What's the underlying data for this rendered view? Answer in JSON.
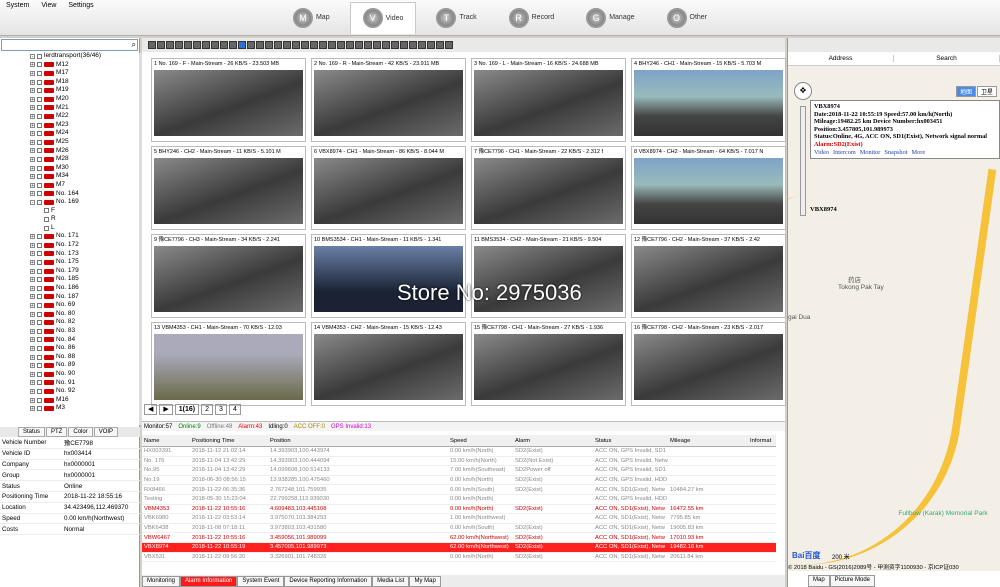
{
  "menu": [
    "System",
    "View",
    "Settings"
  ],
  "nav": [
    {
      "label": "Map",
      "icon": "M"
    },
    {
      "label": "Video",
      "icon": "V",
      "active": true
    },
    {
      "label": "Track",
      "icon": "T"
    },
    {
      "label": "Record",
      "icon": "R"
    },
    {
      "label": "Manage",
      "icon": "G"
    },
    {
      "label": "Other",
      "icon": "O"
    }
  ],
  "tree": {
    "root": "lerdtransport(36/46)",
    "items": [
      "M12",
      "M17",
      "M18",
      "M19",
      "M20",
      "M21",
      "M22",
      "M23",
      "M24",
      "M25",
      "M26",
      "M28",
      "M30",
      "M34",
      "M7",
      "No. 164",
      "No. 169"
    ],
    "children": [
      "F",
      "R",
      "L"
    ],
    "items2": [
      "No. 171",
      "No. 172",
      "No. 173",
      "No. 175",
      "No. 179",
      "No. 185",
      "No. 186",
      "No. 187",
      "No. 69",
      "No. 80",
      "No. 82",
      "No. 83",
      "No. 84",
      "No. 86",
      "No. 88",
      "No. 89",
      "No. 90",
      "No. 91",
      "No. 92",
      "M16",
      "M3"
    ]
  },
  "proptabs": [
    "Status",
    "PTZ",
    "Color",
    "VOIP"
  ],
  "props": [
    {
      "k": "Vehicle Number",
      "v": "豫CE7798"
    },
    {
      "k": "Vehicle ID",
      "v": "hx003414"
    },
    {
      "k": "Company",
      "v": "hx0000001"
    },
    {
      "k": "Group",
      "v": "hx0000001"
    },
    {
      "k": "Status",
      "v": "Online"
    },
    {
      "k": "Positioning Time",
      "v": "2018-11-22 18:55:16"
    },
    {
      "k": "Location",
      "v": "34.423496,112.469370"
    },
    {
      "k": "Speed",
      "v": "0.00 km/h(Northwest)"
    },
    {
      "k": "Costs",
      "v": "Normal"
    }
  ],
  "cells": [
    "1 No. 169 - F - Main-Stream - 26 KB/S - 23.503 MB",
    "2 No. 169 - R - Main-Stream - 42 KB/S - 23.911 MB",
    "3 No. 169 - L - Main-Stream - 16 KB/S - 24.688 MB",
    "4 BHY246 - CH1 - Main-Stream - 15 KB/S - 5.703 M",
    "5 BHY246 - CH2 - Main-Stream - 11 KB/S - 5.101 M",
    "6 VBX8974 - CH1 - Main-Stream - 86 KB/S - 8.044 M",
    "7 豫CE7796 - CH1 - Main-Stream - 22 KB/S - 2.312 f",
    "8 VBX8974 - CH2 - Main-Stream - 64 KB/S - 7.017 N",
    "9 豫CE7796 - CH3 - Main-Stream - 34 KB/S - 2.241",
    "10 BMS3534 - CH1 - Main-Stream - 11 KB/S - 1.341",
    "11 BMS3534 - CH2 - Main-Stream - 21 KB/S - 9.504",
    "12 豫CE7796 - CH2 - Main-Stream - 37 KB/S - 2.42",
    "13 VBM4353 - CH1 - Main-Stream - 70 KB/S - 12.03",
    "14 VBM4353 - CH2 - Main-Stream - 15 KB/S - 12.43",
    "15 豫CE7798 - CH1 - Main-Stream - 27 KB/S - 1.936",
    "16 豫CE7798 - CH2 - Main-Stream - 23 KB/S - 2.017"
  ],
  "pages": [
    "1(16)",
    "2",
    "3",
    "4"
  ],
  "statusline": {
    "monitor": "Monitor:57",
    "online": "Online:9",
    "offline": "Offline:48",
    "alarm": "Alarm:43",
    "idling": "Idling:0",
    "acc": "ACC OFF:0",
    "gps": "GPS Invalid:13"
  },
  "columns": [
    "Name",
    "Positioning Time",
    "Position",
    "Speed",
    "Alarm",
    "Status",
    "Mileage",
    "Informat"
  ],
  "rows": [
    {
      "c": [
        "HX003391",
        "2018-11-12 21:02:14",
        "14.393903,100.443974",
        "0.00 km/h(North)",
        "SD2(Exist)",
        "ACC ON, GPS Invalid, SD1",
        "",
        ""
      ],
      "cls": "gray"
    },
    {
      "c": [
        "No. 176",
        "2018-11-04 13:42:29",
        "14.393903,100.444094",
        "15.00 km/h(North)",
        "SD2(Not Exist)",
        "ACC ON, GPS Invalid, Netw",
        "",
        ""
      ],
      "cls": "gray"
    },
    {
      "c": [
        "No.95",
        "2018-11-04 13:42:29",
        "14.099608,100.514133",
        "7.00 km/h(Southeast)",
        "SD2Power off",
        "ACC ON, GPS Invalid, SD1",
        "",
        ""
      ],
      "cls": "gray"
    },
    {
      "c": [
        "No.19",
        "2018-06-30 08:56:15",
        "13.938285,100.475460",
        "0.00 km/h(North)",
        "SD2(Exist)",
        "ACC ON, GPS Invalid, HDD",
        "",
        ""
      ],
      "cls": "gray"
    },
    {
      "c": [
        "RX8466",
        "2018-11-22 06:35:36",
        "2.767248,101.759935",
        "0.00 km/h(South)",
        "SD2(Exist)",
        "ACC ON, SD1(Exist), Netw",
        "10484.27 km",
        ""
      ],
      "cls": "gray"
    },
    {
      "c": [
        "Testing",
        "2018-05-30 15:23:04",
        "22.799258,113.939030",
        "0.00 km/h(North)",
        "",
        "ACC ON, GPS Invalid, HDD",
        "",
        ""
      ],
      "cls": "gray"
    },
    {
      "c": [
        "VBM4353",
        "2018-11-22 10:55:16",
        "4.609483,103.445108",
        "0.00 km/h(North)",
        "SD2(Exist)",
        "ACC ON, SD1(Exist), Netw",
        "16472.55 km",
        ""
      ],
      "cls": "pink"
    },
    {
      "c": [
        "VBK6980",
        "2018-11-22 03:53:14",
        "3.975070,103.384293",
        "1.00 km/h(Northwest)",
        "",
        "ACC ON, SD1(Exist), Netw",
        "7795.85 km",
        ""
      ],
      "cls": "gray"
    },
    {
      "c": [
        "VBK6438",
        "2018-11-08 07:18:11",
        "3.973803,103.431580",
        "0.00 km/h(South)",
        "SD2(Exist)",
        "ACC ON, SD1(Exist), Netw",
        "19005.83 km",
        ""
      ],
      "cls": "gray"
    },
    {
      "c": [
        "VBW6467",
        "2018-11-22 10:55:16",
        "3.459056,101.989099",
        "62.00 km/h(Northwest)",
        "SD2(Exist)",
        "ACC ON, SD1(Exist), Netw",
        "17010.93 km",
        ""
      ],
      "cls": "pink"
    },
    {
      "c": [
        "VBX8974",
        "2018-11-22 10:55:19",
        "3.457005,101.989973",
        "62.00 km/h(Northwest)",
        "SD2(Exist)",
        "ACC ON, SD1(Exist), Netw",
        "19482.16 km",
        ""
      ],
      "cls": "red"
    },
    {
      "c": [
        "VBX531",
        "2018-11-22 09:56:20",
        "3.326901,101.748326",
        "0.00 km/h(North)",
        "SD2(Exist)",
        "ACC ON, SD1(Exist), Netw",
        "20611.84 km",
        ""
      ],
      "cls": "gray"
    }
  ],
  "btabs": [
    "Monitoring",
    "Alarm Information",
    "System Event",
    "Device Reporting Information",
    "Media List",
    "My Map"
  ],
  "right": {
    "address": "Address",
    "search": "Search",
    "maptypes": [
      "地图",
      "卫星"
    ],
    "info": {
      "name": "VBX8974",
      "date": "Date:2018-11-22 10:55:19",
      "speed": "Speed:57.00 km/h(North)",
      "mileage": "Mileage:19482.25 km",
      "device": "Device Number:hx003451",
      "position": "Position:3.457805,101.989973",
      "status": "Status:Online, 4G, ACC ON, SD1(Exist), Network signal normal",
      "alarm": "Alarm:SD2(Exist)",
      "links": [
        "Video",
        "Intercom",
        "Monitor",
        "Snapshot",
        "More"
      ]
    },
    "marker": "VBX8974",
    "places": [
      "药店",
      "Tokong Pak Tay",
      "gai Dua",
      "Fullbow (Karak) Memorial Park"
    ],
    "brand": "Bai百度",
    "scale": "200 米",
    "copyright": "© 2018 Baidu - GS(2016)2089号 - 甲测资字1100930 - 京ICP证030",
    "tabs": [
      "Map",
      "Picture Mode"
    ]
  },
  "watermark": "Store No: 2975036"
}
